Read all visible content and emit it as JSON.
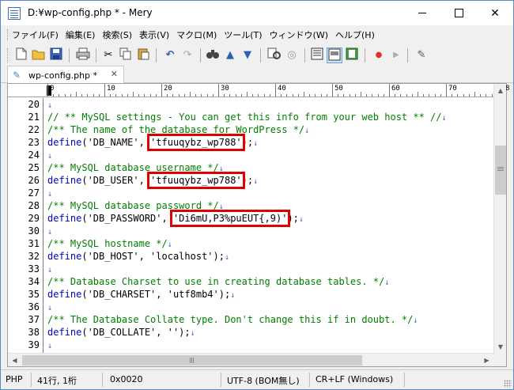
{
  "window": {
    "title": "D:¥wp-config.php * - Mery"
  },
  "menu": [
    "ファイル(F)",
    "編集(E)",
    "検索(S)",
    "表示(V)",
    "マクロ(M)",
    "ツール(T)",
    "ウィンドウ(W)",
    "ヘルプ(H)"
  ],
  "toolbar": {
    "icons": [
      "new-file-icon",
      "open-folder-icon",
      "save-icon",
      "print-icon",
      "cut-icon",
      "copy-icon",
      "paste-icon",
      "undo-icon",
      "redo-icon",
      "find-icon",
      "find-up-icon",
      "find-down-icon",
      "replace-icon",
      "search-files-icon",
      "view-mode-1-icon",
      "view-mode-2-icon",
      "view-mode-3-icon",
      "record-icon",
      "play-icon",
      "tool-icon"
    ]
  },
  "tab": {
    "label": "wp-config.php *",
    "close": "✕"
  },
  "ruler": {
    "labels": [
      "0",
      "10",
      "20",
      "30",
      "40",
      "50",
      "60",
      "70",
      "8"
    ]
  },
  "colors": {
    "comment": "#008000",
    "keyword": "#0000cc",
    "highlight": "#e00000",
    "eol": "#3b72c8"
  },
  "lines": [
    {
      "n": "20",
      "parts": []
    },
    {
      "n": "21",
      "parts": [
        {
          "t": "// ** MySQL settings - You can get this info from your web host ** //",
          "c": "cmt"
        }
      ]
    },
    {
      "n": "22",
      "parts": [
        {
          "t": "/** The name of the database for WordPress */",
          "c": "cmt"
        }
      ]
    },
    {
      "n": "23",
      "parts": [
        {
          "t": "define",
          "c": "kw"
        },
        {
          "t": "('DB_NAME', ",
          "c": "str"
        },
        {
          "t": "'tfuuqybz_wp788'",
          "c": "str",
          "hl": true
        },
        {
          "t": ");",
          "c": "str"
        }
      ]
    },
    {
      "n": "24",
      "parts": []
    },
    {
      "n": "25",
      "parts": [
        {
          "t": "/** MySQL database username */",
          "c": "cmt"
        }
      ]
    },
    {
      "n": "26",
      "parts": [
        {
          "t": "define",
          "c": "kw"
        },
        {
          "t": "('DB_USER', ",
          "c": "str"
        },
        {
          "t": "'tfuuqybz_wp788'",
          "c": "str",
          "hl": true
        },
        {
          "t": ");",
          "c": "str"
        }
      ]
    },
    {
      "n": "27",
      "parts": []
    },
    {
      "n": "28",
      "parts": [
        {
          "t": "/** MySQL database password */",
          "c": "cmt"
        }
      ]
    },
    {
      "n": "29",
      "parts": [
        {
          "t": "define",
          "c": "kw"
        },
        {
          "t": "('DB_PASSWORD', ",
          "c": "str"
        },
        {
          "t": "'Di6mU,P3%puEUT{,9)'",
          "c": "str",
          "hl": true
        },
        {
          "t": ");",
          "c": "str"
        }
      ]
    },
    {
      "n": "30",
      "parts": []
    },
    {
      "n": "31",
      "parts": [
        {
          "t": "/** MySQL hostname */",
          "c": "cmt"
        }
      ]
    },
    {
      "n": "32",
      "parts": [
        {
          "t": "define",
          "c": "kw"
        },
        {
          "t": "('DB_HOST', 'localhost');",
          "c": "str"
        }
      ]
    },
    {
      "n": "33",
      "parts": []
    },
    {
      "n": "34",
      "parts": [
        {
          "t": "/** Database Charset to use in creating database tables. */",
          "c": "cmt"
        }
      ]
    },
    {
      "n": "35",
      "parts": [
        {
          "t": "define",
          "c": "kw"
        },
        {
          "t": "('DB_CHARSET', 'utf8mb4');",
          "c": "str"
        }
      ]
    },
    {
      "n": "36",
      "parts": []
    },
    {
      "n": "37",
      "parts": [
        {
          "t": "/** The Database Collate type. Don't change this if in doubt. */",
          "c": "cmt"
        }
      ]
    },
    {
      "n": "38",
      "parts": [
        {
          "t": "define",
          "c": "kw"
        },
        {
          "t": "('DB_COLLATE', '');",
          "c": "str"
        }
      ]
    },
    {
      "n": "39",
      "parts": []
    }
  ],
  "eol_mark": "↓",
  "status": {
    "mode": "PHP",
    "position": "41行, 1桁",
    "code": "0x0020",
    "encoding": "UTF-8 (BOM無し)",
    "newline": "CR+LF (Windows)"
  }
}
